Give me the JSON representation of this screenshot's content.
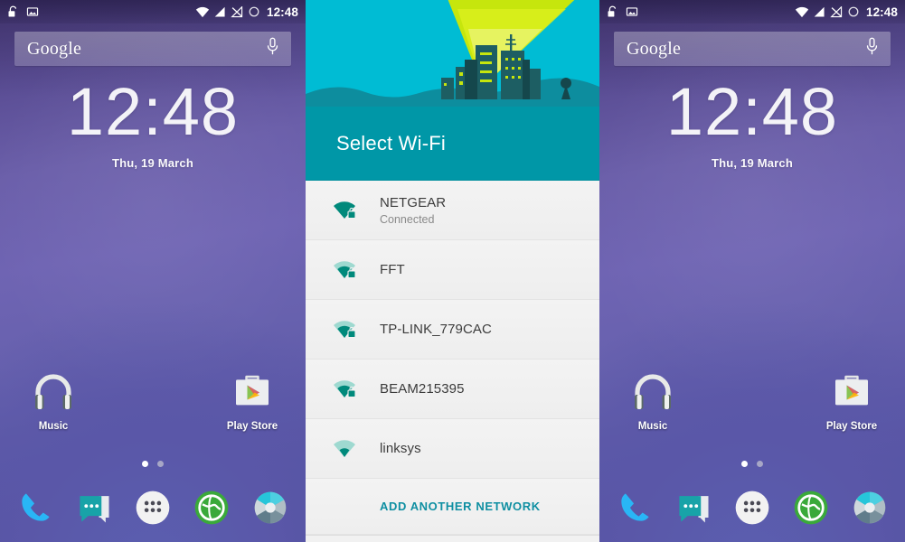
{
  "statusbar": {
    "icons_left": [
      "unlocked-padlock-icon",
      "screenshot-image-icon"
    ],
    "icons_right": [
      "wifi-signal-icon",
      "cellular-signal-icon",
      "no-sim-icon",
      "battery-circle-icon"
    ],
    "time": "12:48"
  },
  "search": {
    "label": "Google",
    "mic_icon": "microphone-icon"
  },
  "clock": {
    "time": "12:48",
    "date": "Thu, 19 March"
  },
  "apps": [
    {
      "label": "Music",
      "icon": "headphones-icon"
    },
    {
      "label": "Play Store",
      "icon": "play-store-icon"
    }
  ],
  "page_dots": {
    "count": 2,
    "active_index": 0
  },
  "dock": [
    {
      "name": "phone",
      "icon": "phone-icon"
    },
    {
      "name": "messaging",
      "icon": "message-bubble-icon"
    },
    {
      "name": "app-drawer",
      "icon": "app-drawer-icon"
    },
    {
      "name": "browser",
      "icon": "globe-browser-icon"
    },
    {
      "name": "camera",
      "icon": "camera-aperture-icon"
    }
  ],
  "wifi": {
    "title": "Select Wi-Fi",
    "hero_illustration": "city-skyline-wifi-broadcast",
    "networks": [
      {
        "ssid": "NETGEAR",
        "status": "Connected",
        "secured": true,
        "strength": 4
      },
      {
        "ssid": "FFT",
        "status": "",
        "secured": true,
        "strength": 3
      },
      {
        "ssid": "TP-LINK_779CAC",
        "status": "",
        "secured": true,
        "strength": 3
      },
      {
        "ssid": "BEAM215395",
        "status": "",
        "secured": true,
        "strength": 3
      },
      {
        "ssid": "linksys",
        "status": "",
        "secured": false,
        "strength": 2
      }
    ],
    "add_network_label": "ADD ANOTHER NETWORK"
  },
  "colors": {
    "hero_cyan": "#00bcd4",
    "title_teal": "#0097a7",
    "wifi_icon_teal": "#00897b",
    "link_teal": "#0f8fa2",
    "wallpaper_purple": "#6761ae"
  }
}
